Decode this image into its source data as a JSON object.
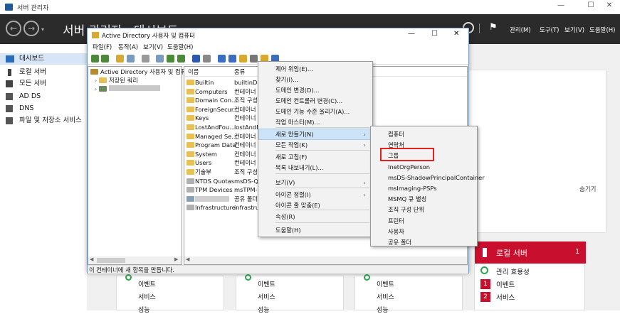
{
  "titlebar": {
    "title": "서버 관리자"
  },
  "header": {
    "title": "서버 관리자 · 대시보드",
    "menus": [
      "관리(M)",
      "도구(T)",
      "보기(V)",
      "도움말(H)"
    ]
  },
  "sidebar": {
    "items": [
      "대시보드",
      "로컬 서버",
      "모든 서버",
      "AD DS",
      "DNS",
      "파일 및 저장소 서비스"
    ]
  },
  "ad_window": {
    "title": "Active Directory 사용자 및 컴퓨터",
    "menu": [
      "파일(F)",
      "동작(A)",
      "보기(V)",
      "도움말(H)"
    ],
    "tree": {
      "root": "Active Directory 사용자 및 컴퓨",
      "saved": "저장된 쿼리"
    },
    "columns": [
      "이름",
      "종류"
    ],
    "rows": [
      {
        "name": "Builtin",
        "type": "builtinDo"
      },
      {
        "name": "Computers",
        "type": "컨테이너"
      },
      {
        "name": "Domain Con...",
        "type": "조직 구성"
      },
      {
        "name": "ForeignSecur...",
        "type": "컨테이너"
      },
      {
        "name": "Keys",
        "type": "컨테이너"
      },
      {
        "name": "LostAndFou...",
        "type": "lostAndFo"
      },
      {
        "name": "Managed Se...",
        "type": "컨테이너"
      },
      {
        "name": "Program Data",
        "type": "컨테이너"
      },
      {
        "name": "System",
        "type": "컨테이너"
      },
      {
        "name": "Users",
        "type": "컨테이너"
      },
      {
        "name": "기술부",
        "type": "조직 구성"
      },
      {
        "name": "NTDS Quotas",
        "type": "msDS-Quo"
      },
      {
        "name": "TPM Devices",
        "type": "msTPM-In"
      },
      {
        "name": "",
        "type": "공유 폴더"
      },
      {
        "name": "Infrastructure",
        "type": "infrastruct"
      }
    ],
    "status": "이 컨테이너에 새 항목을 만듭니다."
  },
  "context_menu": {
    "items": [
      "제어 위임(E)...",
      "찾기(I)...",
      "도메인 변경(D)...",
      "도메인 컨트롤러 변경(C)...",
      "도메인 기능 수준 올리기(A)...",
      "작업 마스터(M)...",
      "새로 만들기(N)",
      "모든 작업(K)",
      "새로 고침(F)",
      "목록 내보내기(L)...",
      "보기(V)",
      "아이콘 정렬(I)",
      "아이콘 줄 맞춤(E)",
      "속성(R)",
      "도움말(H)"
    ]
  },
  "submenu": {
    "items": [
      "컴퓨터",
      "연락처",
      "그룹",
      "InetOrgPerson",
      "msDS-ShadowPrincipalContainer",
      "msImaging-PSPs",
      "MSMQ 큐 별칭",
      "조직 구성 단위",
      "프린터",
      "사용자",
      "공유 폴더"
    ]
  },
  "dashboard": {
    "hide": "숨기기",
    "local_server": {
      "title": "로컬 서버",
      "count": "1",
      "rows": [
        {
          "label": "관리 효용성",
          "badge": ""
        },
        {
          "label": "이벤트",
          "badge": "1"
        },
        {
          "label": "서비스",
          "badge": "2"
        }
      ]
    },
    "tile_rows": [
      "이벤트",
      "서비스",
      "성능"
    ]
  }
}
